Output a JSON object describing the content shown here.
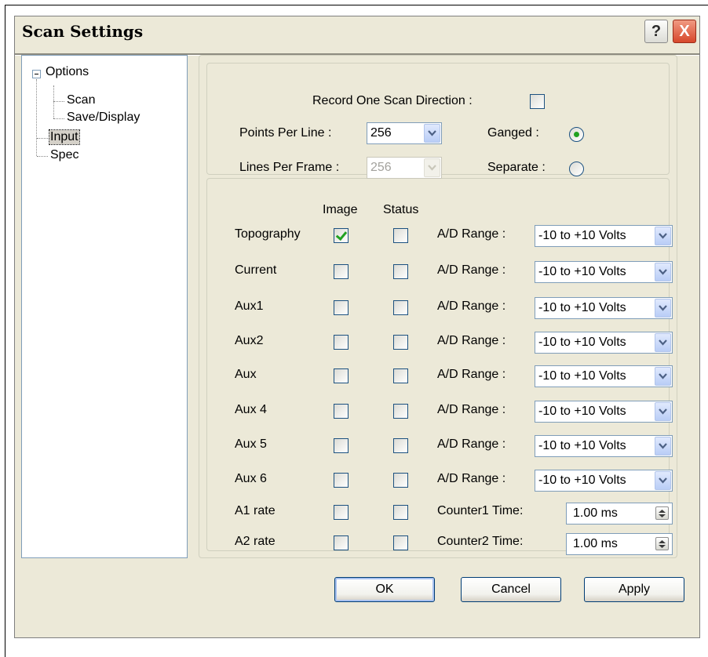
{
  "window": {
    "title": "Scan Settings",
    "help_glyph": "?",
    "close_glyph": "X"
  },
  "tree": {
    "root": "Options",
    "children": [
      "Scan",
      "Save/Display"
    ],
    "siblings": [
      "Input",
      "Spec"
    ],
    "selected": "Input"
  },
  "scan_direction": {
    "record_one_label": "Record One Scan Direction :",
    "record_one_checked": false,
    "points_label": "Points Per Line :",
    "points_value": "256",
    "lines_label": "Lines Per Frame :",
    "lines_value": "256",
    "ganged_label": "Ganged :",
    "separate_label": "Separate :",
    "selected_mode": "Ganged"
  },
  "channels": {
    "image_header": "Image",
    "status_header": "Status",
    "range_label": "A/D Range :",
    "range_value": "-10 to +10 Volts",
    "rows": [
      {
        "name": "Topography",
        "image": true,
        "status": false
      },
      {
        "name": "Current",
        "image": false,
        "status": false
      },
      {
        "name": "Aux1",
        "image": false,
        "status": false
      },
      {
        "name": "Aux2",
        "image": false,
        "status": false
      },
      {
        "name": "Aux",
        "image": false,
        "status": false
      },
      {
        "name": "Aux 4",
        "image": false,
        "status": false
      },
      {
        "name": "Aux 5",
        "image": false,
        "status": false
      },
      {
        "name": "Aux 6",
        "image": false,
        "status": false
      },
      {
        "name": "A1 rate",
        "image": false,
        "status": false
      },
      {
        "name": "A2 rate",
        "image": false,
        "status": false
      }
    ],
    "counters": [
      {
        "label": "Counter1 Time:",
        "value": "1.00 ms"
      },
      {
        "label": "Counter2 Time:",
        "value": "1.00 ms"
      }
    ]
  },
  "buttons": {
    "ok": "OK",
    "cancel": "Cancel",
    "apply": "Apply"
  },
  "colors": {
    "dialog_bg": "#ece9d8",
    "check_green": "#21a121",
    "field_border": "#7f9db9",
    "close_red": "#d7482b"
  }
}
